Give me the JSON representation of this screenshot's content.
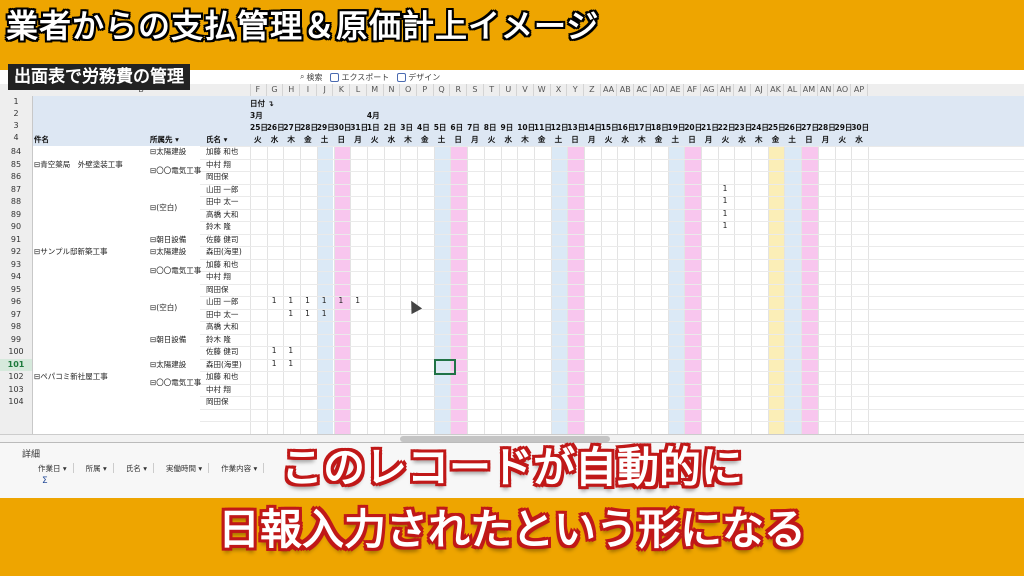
{
  "title": "業者からの支払管理＆原価計上イメージ",
  "subtitle": "出面表で労務費の管理",
  "toolbar": {
    "search": "検索",
    "export": "エクスポート",
    "design": "デザイン"
  },
  "columns": [
    "B",
    "F",
    "G",
    "H",
    "I",
    "J",
    "K",
    "L",
    "M",
    "N",
    "O",
    "P",
    "Q",
    "R",
    "S",
    "T",
    "U",
    "V",
    "W",
    "X",
    "Y",
    "Z",
    "AA",
    "AB",
    "AC",
    "AD",
    "AE",
    "AF",
    "AG",
    "AH",
    "AI",
    "AJ",
    "AK",
    "AL",
    "AM",
    "AN",
    "AO",
    "AP"
  ],
  "pivot": {
    "date_field": "日付",
    "months": [
      "3月",
      "4月"
    ],
    "headers": {
      "project": "件名",
      "company": "所属先",
      "name": "氏名"
    },
    "dates": [
      "25日",
      "26日",
      "27日",
      "28日",
      "29日",
      "30日",
      "31日",
      "1日",
      "2日",
      "3日",
      "4日",
      "5日",
      "6日",
      "7日",
      "8日",
      "9日",
      "10日",
      "11日",
      "12日",
      "13日",
      "14日",
      "15日",
      "16日",
      "17日",
      "18日",
      "19日",
      "20日",
      "21日",
      "22日",
      "23日",
      "24日",
      "25日",
      "26日",
      "27日",
      "28日",
      "29日",
      "30日"
    ],
    "weekdays": [
      "火",
      "水",
      "木",
      "金",
      "土",
      "日",
      "月",
      "火",
      "水",
      "木",
      "金",
      "土",
      "日",
      "月",
      "火",
      "水",
      "木",
      "金",
      "土",
      "日",
      "月",
      "火",
      "水",
      "木",
      "金",
      "土",
      "日",
      "月",
      "火",
      "水",
      "木",
      "金",
      "土",
      "日",
      "月",
      "火",
      "水"
    ]
  },
  "row_numbers": [
    "1",
    "2",
    "3",
    "4",
    "84",
    "85",
    "86",
    "87",
    "88",
    "89",
    "90",
    "91",
    "92",
    "93",
    "94",
    "95",
    "96",
    "97",
    "98",
    "99",
    "100",
    "101",
    "102",
    "103",
    "104"
  ],
  "projects": [
    "青空薬局　外壁塗装工事",
    "サンプル邸新築工事",
    "ペパコミ新社屋工事"
  ],
  "companies": [
    "太陽建設",
    "〇〇電気工事",
    "(空白)",
    "朝日設備",
    "太陽建設",
    "〇〇電気工事",
    "(空白)",
    "朝日設備",
    "太陽建設",
    "〇〇電気工事"
  ],
  "workers": [
    "加藤 和也",
    "中村 翔",
    "岡田保",
    "山田 一郎",
    "田中 太一",
    "高橋 大和",
    "鈴木 隆",
    "佐藤 健司",
    "森田(海里)",
    "加藤 和也",
    "中村 翔",
    "岡田保",
    "山田 一郎",
    "田中 太一",
    "高橋 大和",
    "鈴木 隆",
    "佐藤 健司",
    "森田(海里)",
    "加藤 和也",
    "中村 翔",
    "岡田保"
  ],
  "ones": [
    "1",
    "1",
    "1",
    "1",
    "1",
    "1",
    "1",
    "1",
    "1",
    "1",
    "1",
    "1",
    "1",
    "1",
    "1",
    "1",
    "1",
    "1",
    "1"
  ],
  "detail": {
    "tab": "詳細",
    "columns": [
      "作業日",
      "所属",
      "氏名",
      "実働時間",
      "作業内容"
    ],
    "sigma": "Σ"
  },
  "caption": {
    "line1": "このレコードが自動的に",
    "line2": "日報入力されたという形になる"
  }
}
